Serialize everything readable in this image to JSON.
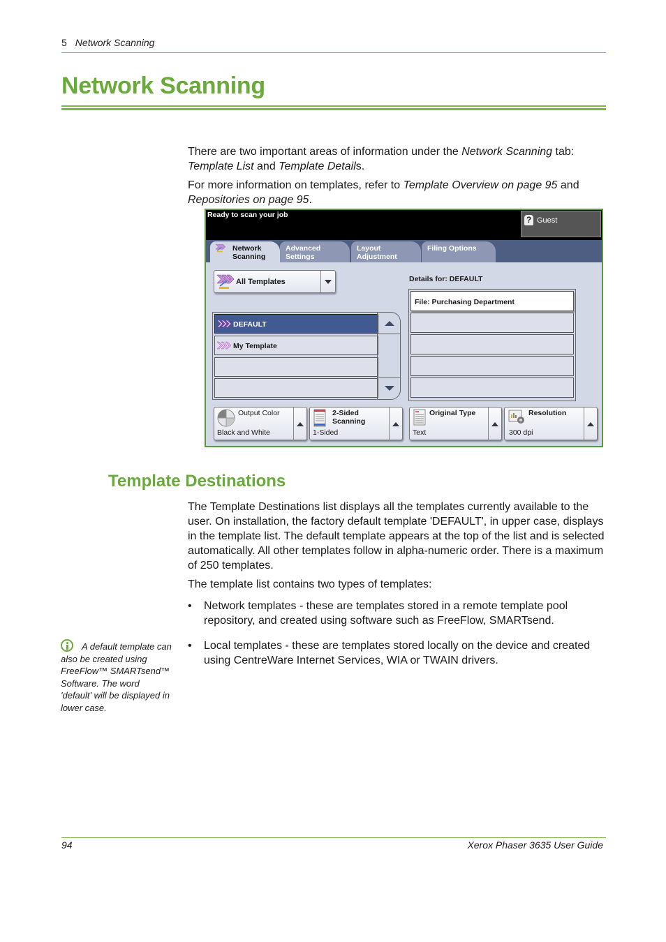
{
  "header": {
    "chapter_number": "5",
    "chapter_title": "Network Scanning"
  },
  "page_title": "Network Scanning",
  "intro": {
    "p1_a": "There are two important areas of information under the ",
    "p1_em1": "Network Scanning",
    "p1_b": " tab: ",
    "p1_em2": "Template List",
    "p1_c": " and ",
    "p1_em3": "Template Detail",
    "p1_d": "s.",
    "p2_a": "For more information on templates, refer to ",
    "p2_em1": "Template Overview on page 95",
    "p2_b": " and ",
    "p2_em2": "Repositories on page 95",
    "p2_c": "."
  },
  "device_ui": {
    "status_message": "Ready to scan your job",
    "user_button": {
      "icon": "help-icon",
      "label": "Guest"
    },
    "tabs": [
      {
        "line1": "Network",
        "line2": "Scanning",
        "active": true,
        "icon": "network-scan-icon"
      },
      {
        "line1": "Advanced",
        "line2": "Settings",
        "active": false
      },
      {
        "line1": "Layout",
        "line2": "Adjustment",
        "active": false
      },
      {
        "line1": "Filing Options",
        "line2": "",
        "active": false
      }
    ],
    "filter_dropdown": {
      "selected": "All Templates",
      "icon": "templates-icon"
    },
    "template_list": [
      {
        "label": "DEFAULT",
        "selected": true,
        "icon": "template-chevron-icon"
      },
      {
        "label": "My Template",
        "selected": false,
        "icon": "template-chevron-icon"
      },
      {
        "label": "",
        "selected": false
      },
      {
        "label": "",
        "selected": false
      }
    ],
    "details_label": "Details for: DEFAULT",
    "details": [
      "File: Purchasing Department",
      "",
      "",
      "",
      ""
    ],
    "features": [
      {
        "title": "Output Color",
        "bold": false,
        "value": "Black and White",
        "icon": "output-color-icon"
      },
      {
        "title_line1": "2-Sided",
        "title_line2": "Scanning",
        "bold": true,
        "value": "1-Sided",
        "icon": "two-sided-icon"
      },
      {
        "title": "Original Type",
        "bold": true,
        "value": "Text",
        "icon": "original-type-icon"
      },
      {
        "title": "Resolution",
        "bold": true,
        "value": "300 dpi",
        "icon": "resolution-icon"
      }
    ]
  },
  "section": {
    "title": "Template Destinations",
    "p1": "The Template Destinations list displays all the templates currently available to the user. On installation, the factory default template 'DEFAULT', in upper case, displays in the template list. The default template appears at the top of the list and is selected automatically. All other templates follow in alpha-numeric order. There is a maximum of 250 templates.",
    "p2": "The template list contains two types of templates:",
    "bullets": [
      "Network templates - these are templates stored in a remote template pool repository, and created using software such as FreeFlow, SMARTsend.",
      "Local templates - these are templates stored locally on the device and created using CentreWare Internet Services, WIA or TWAIN drivers."
    ],
    "bullet_glyph": "•"
  },
  "note": {
    "icon": "info-icon",
    "text": "A default template can also be created using FreeFlow™ SMARTsend™ Software. The word 'default' will be displayed in lower case."
  },
  "footer": {
    "page_number": "94",
    "guide_title": "Xerox Phaser 3635 User Guide"
  },
  "colors": {
    "accent_green": "#6aaa3a",
    "ui_selected_blue": "#425a92",
    "ui_tabbar": "#4d5e82",
    "ui_panel": "#d3d8e6"
  }
}
